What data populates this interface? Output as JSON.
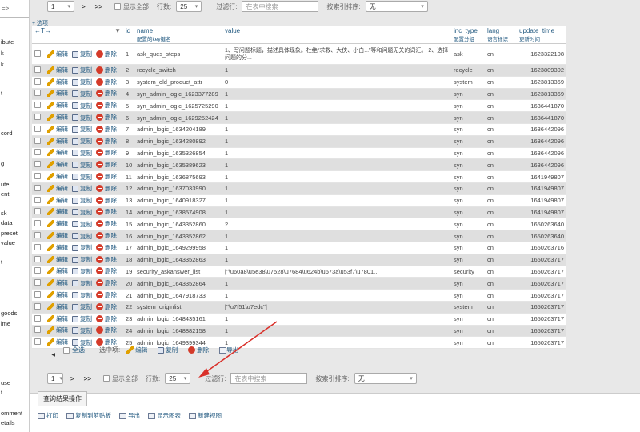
{
  "sidebar": {
    "top": "=>",
    "items": [
      "ibute",
      "k",
      "k",
      "t",
      "cord",
      "g",
      "ute",
      "ent",
      "sk",
      "data",
      "preset",
      "value",
      "t",
      "goods",
      "ime",
      "use",
      "t",
      "omment",
      "etails"
    ]
  },
  "nav_top": {
    "page_value": "1",
    "next": ">",
    "last": ">>",
    "show_all": "显示全部",
    "rows_label": "行数:",
    "rows_value": "25",
    "filter_label": "过滤行:",
    "filter_placeholder": "在表中搜索",
    "sort_label": "按索引排序:",
    "sort_value": "无"
  },
  "collapse_link": "+ 选项",
  "columns": {
    "name": {
      "label": "name",
      "sub": "配置的key键名"
    },
    "id": "id",
    "value": "value",
    "inc_type": {
      "label": "inc_type",
      "sub": "配置分组"
    },
    "lang": {
      "label": "lang",
      "sub": "语言标识"
    },
    "update_time": {
      "label": "update_time",
      "sub": "更新时间"
    }
  },
  "header_nav": "←T→",
  "actions": {
    "edit": "编辑",
    "copy": "复制",
    "delete": "删除"
  },
  "rows": [
    {
      "id": "1",
      "name": "ask_ques_steps",
      "value": "1、写问题标题，描述具体现象。杜绝“求救、大侠、小白...”等和问题无关的词汇。 2、选择问题的分...",
      "inc_type": "ask",
      "lang": "cn",
      "update_time": "1623322108"
    },
    {
      "id": "2",
      "name": "recycle_switch",
      "value": "1",
      "inc_type": "recycle",
      "lang": "cn",
      "update_time": "1623809302"
    },
    {
      "id": "3",
      "name": "system_old_product_attr",
      "value": "0",
      "inc_type": "system",
      "lang": "cn",
      "update_time": "1623813369"
    },
    {
      "id": "4",
      "name": "syn_admin_logic_1623377289",
      "value": "1",
      "inc_type": "syn",
      "lang": "cn",
      "update_time": "1623813369"
    },
    {
      "id": "5",
      "name": "syn_admin_logic_1625725290",
      "value": "1",
      "inc_type": "syn",
      "lang": "cn",
      "update_time": "1636441870"
    },
    {
      "id": "6",
      "name": "syn_admin_logic_1629252424",
      "value": "1",
      "inc_type": "syn",
      "lang": "cn",
      "update_time": "1636441870"
    },
    {
      "id": "7",
      "name": "admin_logic_1634204189",
      "value": "1",
      "inc_type": "syn",
      "lang": "cn",
      "update_time": "1636442096"
    },
    {
      "id": "8",
      "name": "admin_logic_1634280892",
      "value": "1",
      "inc_type": "syn",
      "lang": "cn",
      "update_time": "1636442096"
    },
    {
      "id": "9",
      "name": "admin_logic_1635326854",
      "value": "1",
      "inc_type": "syn",
      "lang": "cn",
      "update_time": "1636442096"
    },
    {
      "id": "10",
      "name": "admin_logic_1635389623",
      "value": "1",
      "inc_type": "syn",
      "lang": "cn",
      "update_time": "1636442096"
    },
    {
      "id": "11",
      "name": "admin_logic_1636875693",
      "value": "1",
      "inc_type": "syn",
      "lang": "cn",
      "update_time": "1641949807"
    },
    {
      "id": "12",
      "name": "admin_logic_1637033990",
      "value": "1",
      "inc_type": "syn",
      "lang": "cn",
      "update_time": "1641949807"
    },
    {
      "id": "13",
      "name": "admin_logic_1640918327",
      "value": "1",
      "inc_type": "syn",
      "lang": "cn",
      "update_time": "1641949807"
    },
    {
      "id": "14",
      "name": "admin_logic_1638574908",
      "value": "1",
      "inc_type": "syn",
      "lang": "cn",
      "update_time": "1641949807"
    },
    {
      "id": "15",
      "name": "admin_logic_1643352860",
      "value": "2",
      "inc_type": "syn",
      "lang": "cn",
      "update_time": "1650263640"
    },
    {
      "id": "16",
      "name": "admin_logic_1643352862",
      "value": "1",
      "inc_type": "syn",
      "lang": "cn",
      "update_time": "1650263640"
    },
    {
      "id": "17",
      "name": "admin_logic_1649299958",
      "value": "1",
      "inc_type": "syn",
      "lang": "cn",
      "update_time": "1650263716"
    },
    {
      "id": "18",
      "name": "admin_logic_1643352863",
      "value": "1",
      "inc_type": "syn",
      "lang": "cn",
      "update_time": "1650263717"
    },
    {
      "id": "19",
      "name": "security_askanswer_list",
      "value": "[\"\\u60a8\\u5e38\\u7528\\u7684\\u624b\\u673a\\u53f7\\u7801...",
      "inc_type": "security",
      "lang": "cn",
      "update_time": "1650263717"
    },
    {
      "id": "20",
      "name": "admin_logic_1643352864",
      "value": "1",
      "inc_type": "syn",
      "lang": "cn",
      "update_time": "1650263717"
    },
    {
      "id": "21",
      "name": "admin_logic_1647918733",
      "value": "1",
      "inc_type": "syn",
      "lang": "cn",
      "update_time": "1650263717"
    },
    {
      "id": "22",
      "name": "system_originlist",
      "value": "[\"\\u7f51\\u7edc\"]",
      "inc_type": "system",
      "lang": "cn",
      "update_time": "1650263717"
    },
    {
      "id": "23",
      "name": "admin_logic_1648435161",
      "value": "1",
      "inc_type": "syn",
      "lang": "cn",
      "update_time": "1650263717"
    },
    {
      "id": "24",
      "name": "admin_logic_1648882158",
      "value": "1",
      "inc_type": "syn",
      "lang": "cn",
      "update_time": "1650263717"
    },
    {
      "id": "25",
      "name": "admin_logic_1649399344",
      "value": "1",
      "inc_type": "syn",
      "lang": "cn",
      "update_time": "1650263717"
    }
  ],
  "bulk": {
    "select_all": "全选",
    "selected_label": "选中项:",
    "edit": "编辑",
    "copy": "复制",
    "delete": "删除",
    "export": "导出"
  },
  "nav_bottom": {
    "page_value": "1",
    "next": ">",
    "last": ">>",
    "show_all": "显示全部",
    "rows_label": "行数:",
    "rows_value": "25",
    "filter_label": "过滤行:",
    "filter_placeholder": "在表中搜索",
    "sort_label": "按索引排序:",
    "sort_value": "无"
  },
  "ops": {
    "title": "查询结果操作",
    "print": "打印",
    "copy_clipboard": "复制到剪贴板",
    "export": "导出",
    "chart": "显示图表",
    "create_view": "新建视图"
  },
  "colors": {
    "link": "#235a81",
    "row_alt": "#dfdfdf",
    "annotation": "#d9302a",
    "delete": "#d43b2a"
  }
}
